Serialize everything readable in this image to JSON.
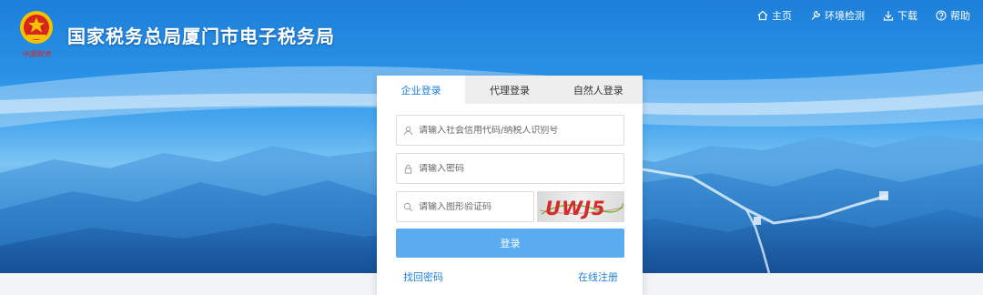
{
  "header": {
    "title": "国家税务总局厦门市电子税务局",
    "logo_icon": "national-tax-emblem-icon",
    "logo_caption": "中国税务"
  },
  "topnav": [
    {
      "label": "主页",
      "icon": "home-icon"
    },
    {
      "label": "环境检测",
      "icon": "wrench-icon"
    },
    {
      "label": "下载",
      "icon": "download-icon"
    },
    {
      "label": "帮助",
      "icon": "help-icon"
    }
  ],
  "login": {
    "tabs": [
      {
        "label": "企业登录",
        "active": true
      },
      {
        "label": "代理登录",
        "active": false
      },
      {
        "label": "自然人登录",
        "active": false
      }
    ],
    "id_field": {
      "placeholder": "请输入社会信用代码/纳税人识别号",
      "icon": "user-icon"
    },
    "password_field": {
      "placeholder": "请输入密码",
      "icon": "lock-icon"
    },
    "captcha_field": {
      "placeholder": "请输入图形验证码",
      "icon": "search-icon"
    },
    "captcha_text": "UWJ5",
    "login_button": "登录",
    "forgot_password": "找回密码",
    "register": "在线注册"
  },
  "colors": {
    "accent": "#1f7fd9",
    "button": "#5aabef",
    "banner_top": "#1d7fd9"
  }
}
